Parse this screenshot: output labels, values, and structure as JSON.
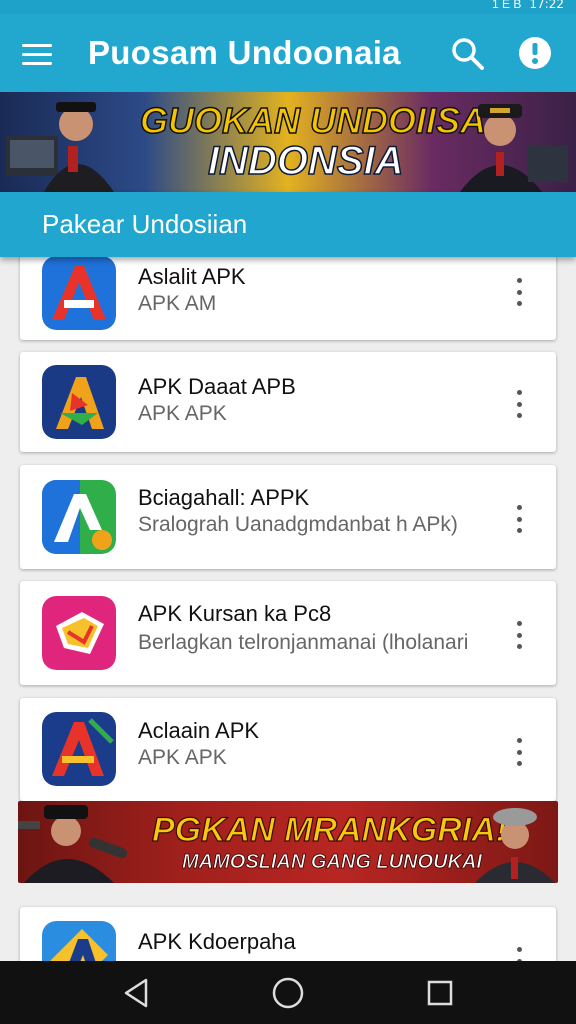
{
  "status_bar": {
    "clock": "17:22",
    "signal_text": "1 E B"
  },
  "toolbar": {
    "title": "Puosam Undoonaia",
    "menu_icon": "hamburger-menu-icon",
    "search_icon": "search-icon",
    "info_icon": "info-icon"
  },
  "banner_top": {
    "line1": "GUOKAN UNDOIISAN",
    "line2": "INDONSIA"
  },
  "section": {
    "label": "Pakear Undosiian"
  },
  "apps": [
    {
      "name": "Aslalit APK",
      "subtitle": "APK AM",
      "icon_color": "#1e6fd9"
    },
    {
      "name": "APK Daaat APB",
      "subtitle": "APK APK",
      "icon_color": "#1b3a86"
    },
    {
      "name": "Bciagahall: APPK",
      "subtitle": "Sralograh Uanadgmdanbat h APk)",
      "icon_color": "#2fae4a"
    },
    {
      "name": "APK Kursan ka Pc8",
      "subtitle": "Berlagkan telronjanmanai (lholanari",
      "icon_color": "#e0257c"
    },
    {
      "name": "Aclaain APK",
      "subtitle": "APK APK",
      "icon_color": "#1a3c8a"
    },
    {
      "name": "APK Kdoerpaha",
      "subtitle": "",
      "icon_color": "#2a8de0"
    }
  ],
  "banner_mid": {
    "line1": "PGKAN MRANKGRIA!",
    "line2": "MAMOSLIAN  GANG LUNOUKAI"
  },
  "navbar": {
    "back_icon": "back-triangle-icon",
    "home_icon": "home-circle-icon",
    "recents_icon": "recents-square-icon"
  },
  "colors": {
    "toolbar": "#22a7cf",
    "subheader": "#20a6cf",
    "navbar": "#111111"
  }
}
